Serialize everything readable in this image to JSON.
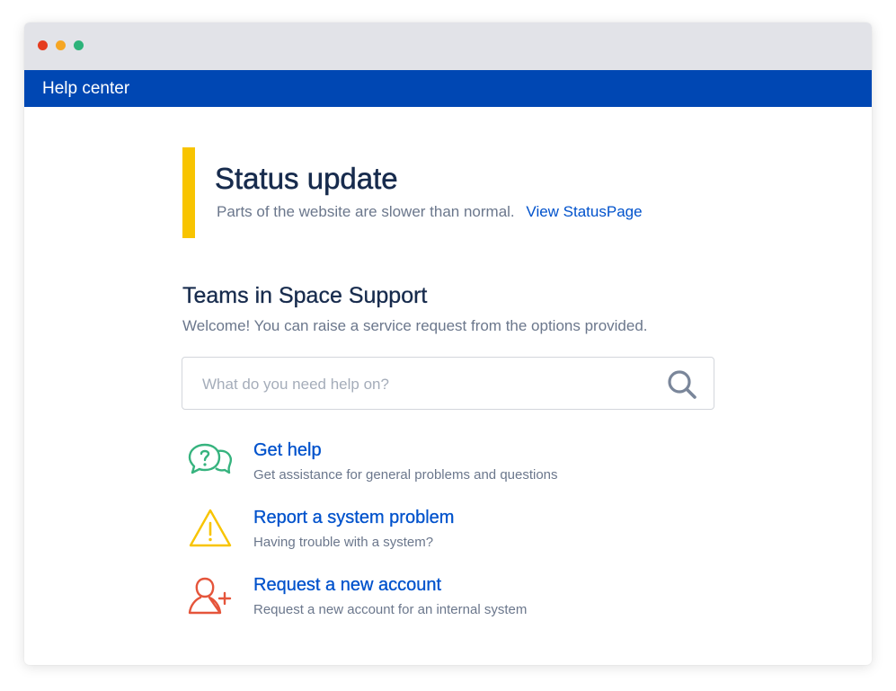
{
  "app": {
    "title": "Help center"
  },
  "status": {
    "title": "Status update",
    "message": "Parts of the website are slower than normal.",
    "link": "View StatusPage"
  },
  "portal": {
    "title": "Teams in Space Support",
    "subtitle": "Welcome! You can raise a service request from the options provided."
  },
  "search": {
    "placeholder": "What do you need help on?",
    "value": ""
  },
  "options": [
    {
      "label": "Get help",
      "description": "Get assistance for general problems and questions",
      "icon": "chat-bubbles-question-icon",
      "color": "#36b37e"
    },
    {
      "label": "Report a system problem",
      "description": "Having trouble with a system?",
      "icon": "warning-triangle-icon",
      "color": "#f8c400"
    },
    {
      "label": "Request a new account",
      "description": "Request a new account for an internal system",
      "icon": "add-user-icon",
      "color": "#e5553b"
    }
  ],
  "colors": {
    "brand": "#0047b3",
    "link": "#0052cc",
    "status_accent": "#f8c400"
  }
}
